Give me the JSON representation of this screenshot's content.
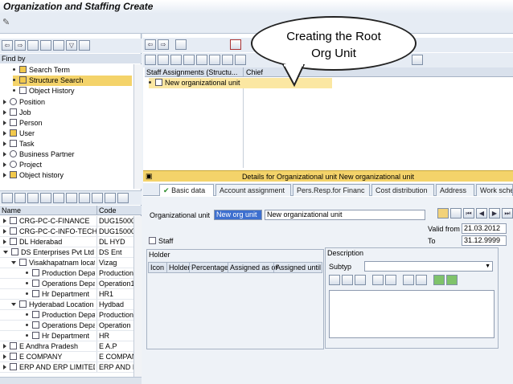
{
  "window": {
    "title": "Organization and Staffing Create"
  },
  "find_by": {
    "header": "Find by",
    "items": [
      {
        "label": "Search Term"
      },
      {
        "label": "Structure Search",
        "selected": true
      },
      {
        "label": "Object History"
      }
    ],
    "categories": [
      "Position",
      "Job",
      "Person",
      "User",
      "Task",
      "Business Partner",
      "Project",
      "Object history"
    ]
  },
  "hit_list": {
    "headers": [
      "Name",
      "Code"
    ],
    "rows": [
      {
        "name": "CRG-PC-C-FINANCE",
        "code": "DUG15000"
      },
      {
        "name": "CRG-PC-C-INFO-TECHNO",
        "code": "DUG15000"
      },
      {
        "name": "DL Hderabad",
        "code": "DL HYD"
      },
      {
        "name": "DS Enterprises Pvt Ltd",
        "code": "DS Ent"
      },
      {
        "name": "Visakhapatnam locati",
        "code": "Vizag"
      },
      {
        "name": "Production Depa",
        "code": "Production"
      },
      {
        "name": "Operations Depa",
        "code": "Operation1"
      },
      {
        "name": "Hr Department",
        "code": "HR1"
      },
      {
        "name": "Hyderabad Location",
        "code": "Hydbad"
      },
      {
        "name": "Production Depa",
        "code": "Production"
      },
      {
        "name": "Operations Depa",
        "code": "Operation"
      },
      {
        "name": "Hr Department",
        "code": "HR"
      },
      {
        "name": "E Andhra Pradesh",
        "code": "E A.P"
      },
      {
        "name": "E COMPANY",
        "code": "E COMPAN"
      },
      {
        "name": "ERP AND ERP LIMITED(E",
        "code": "ERP AND E"
      }
    ]
  },
  "structure": {
    "headers": [
      "Staff Assignments (Structu...",
      "Chief"
    ],
    "root": "New organizational unit"
  },
  "callout": {
    "line1": "Creating the Root",
    "line2": "Org Unit"
  },
  "details": {
    "title": "Details for Organizational unit New organizational unit",
    "tabs": [
      "Basic data",
      "Account assignment",
      "Pers.Resp.for Financ",
      "Cost distribution",
      "Address",
      "Work sche"
    ]
  },
  "form": {
    "org_unit_label": "Organizational unit",
    "org_unit_abbr": "New org unit",
    "org_unit_name": "New organizational unit",
    "valid_from_label": "Valid from",
    "valid_from": "21.03.2012",
    "to_label": "To",
    "to": "31.12.9999",
    "staff_label": "Staff",
    "holder_title": "Holder",
    "holder_cols": [
      "Icon",
      "Holder",
      "Percentage",
      "Assigned as of",
      "Assigned until"
    ],
    "description_title": "Description",
    "subtype_label": "Subtyp"
  }
}
